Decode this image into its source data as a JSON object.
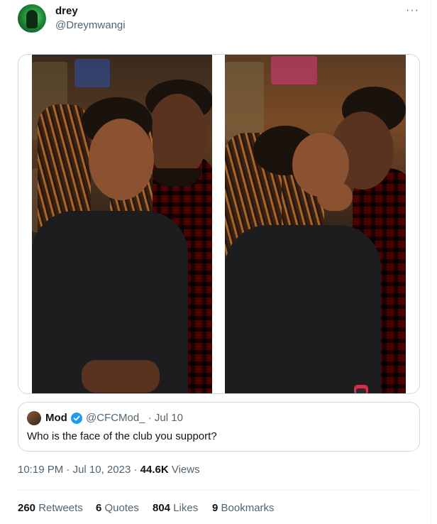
{
  "author": {
    "display_name": "drey",
    "handle": "@Dreymwangi",
    "avatar_icon": "profile-avatar"
  },
  "more_icon": "···",
  "media": {
    "photo_count": 2
  },
  "quoted_tweet": {
    "name": "Mod",
    "handle": "@CFCMod_",
    "date": "· Jul 10",
    "text": "Who is the face of the club you support?",
    "verified_color": "#1d9bf0"
  },
  "meta": {
    "time": "10:19 PM",
    "sep1": "·",
    "date": "Jul 10, 2023",
    "sep2": "·",
    "views_count": "44.6K",
    "views_label": "Views"
  },
  "stats": {
    "retweets_count": "260",
    "retweets_label": "Retweets",
    "quotes_count": "6",
    "quotes_label": "Quotes",
    "likes_count": "804",
    "likes_label": "Likes",
    "bookmarks_count": "9",
    "bookmarks_label": "Bookmarks"
  }
}
